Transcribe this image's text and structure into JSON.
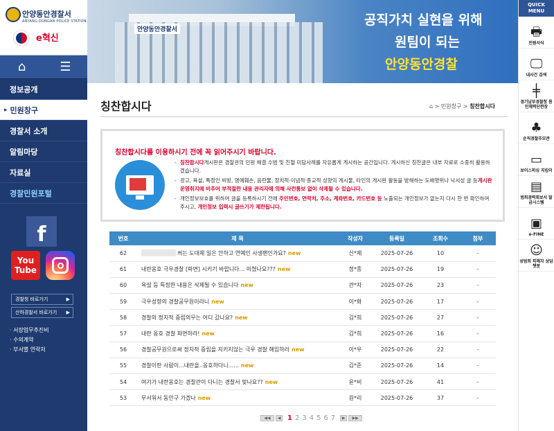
{
  "logo": {
    "name": "안양동안경찰서",
    "sub": "ANYANG DONGAN POLICE STATION",
    "innovation": "e혁신"
  },
  "nav": {
    "items": [
      {
        "label": "정보공개",
        "active": false
      },
      {
        "label": "민원창구",
        "active": true
      },
      {
        "label": "경찰서 소개",
        "active": false
      },
      {
        "label": "알림마당",
        "active": false
      },
      {
        "label": "자료실",
        "active": false
      },
      {
        "label": "경찰민원포털",
        "active": false
      }
    ],
    "active_marker": "▸"
  },
  "social": {
    "facebook": "f",
    "youtube_top": "You",
    "youtube_bottom": "Tube"
  },
  "quick_links": [
    {
      "label": "경찰청 바로가기"
    },
    {
      "label": "산하경찰서 바로가기"
    }
  ],
  "side_links": [
    "· 서장업무추진비",
    "· 수의계약",
    "· 부서별 연락처"
  ],
  "banner": {
    "line1": "공직가치 실현을 위해",
    "line2": "원팀이 되는",
    "line3": "안양동안경찰",
    "building_sign": "안양동안경찰서"
  },
  "quick_menu": {
    "title_1": "QUICK",
    "title_2": "MENU",
    "items": [
      {
        "label": "민원서식",
        "icon": "printer-icon"
      },
      {
        "label": "내사건 검색",
        "icon": "monitor-search-icon"
      },
      {
        "label": "경기남부경찰청 용인체력단련장",
        "icon": "dumbbell-icon"
      },
      {
        "label": "순직경찰추모관",
        "icon": "sprout-icon"
      },
      {
        "label": "보이스피싱 지킴이",
        "icon": "laptop-icon"
      },
      {
        "label": "범죄경력회보서 발급시스템",
        "icon": "printer-doc-icon"
      },
      {
        "label": "e-FINE",
        "icon": "car-monitor-icon"
      },
      {
        "label": "성범죄 피해자 상담 챗봇",
        "icon": "robot-icon"
      }
    ]
  },
  "page": {
    "title": "칭찬합시다",
    "breadcrumb": [
      "민원창구",
      "칭찬합시다"
    ]
  },
  "notice": {
    "title": "칭찬합시다를 이용하시기 전에 꼭 읽어주시기 바랍니다.",
    "item1_hl": "칭찬합시다",
    "item1_text": "게시판은 경찰관의 민원 해결 수범 및 친절 미담사례를 자유롭게 게시하는 공간입니다. 게시하신 칭찬글은 내부 자료로 소중히 활용하겠습니다.",
    "item2_text": "광고, 욕설, 특정인 비방, 명예훼손, 음란물, 정치적·이념적·종교적 성향의 게시물, 타인의 게시판 활동을 방해하는 도배행위나 낙서성 글 등",
    "item2_hl": "게시판 운영취지에 비추어 부적절한 내용 관리자에 의해 사전통보 없이 삭제될 수 있습니다.",
    "item3_pre": "개인정보보호를 위하여 글을 등록하시기 전에",
    "item3_hl": "주민번호, 연락처, 주소, 계좌번호, 카드번호 등",
    "item3_mid": "노출되는 개인정보가 없는지 다시 한 번 확인하여 주시고,",
    "item3_hl2": "개인정보 입력시 글쓰기가 제한됩니다."
  },
  "table": {
    "headers": [
      "번호",
      "제 목",
      "작성자",
      "등록일",
      "조회수",
      "첨부"
    ],
    "new_label": "new",
    "rows": [
      {
        "no": "62",
        "subject": "씌는 도대체 일은 안하고 연예인 사생팬인가요?",
        "author": "신*제",
        "date": "2025-07-26",
        "views": "10",
        "file": "-",
        "blurred": true
      },
      {
        "no": "61",
        "subject": "내란옹호 극우경찰 [파면] 시키기 바랍니다... 미쳤나요???",
        "author": "정*종",
        "date": "2025-07-26",
        "views": "19",
        "file": "-",
        "blurred": false
      },
      {
        "no": "60",
        "subject": "욕설 등 특정한 내용은 삭제될 수 있습니다",
        "author": "관*자",
        "date": "2025-07-26",
        "views": "23",
        "file": "-",
        "blurred": false
      },
      {
        "no": "59",
        "subject": "극우성향의 경찰공무원이라니",
        "author": "이*화",
        "date": "2025-07-26",
        "views": "17",
        "file": "-",
        "blurred": false
      },
      {
        "no": "58",
        "subject": "경찰의 정치적 중립의무는 어디 갔나요?",
        "author": "김*희",
        "date": "2025-07-26",
        "views": "27",
        "file": "-",
        "blurred": false
      },
      {
        "no": "57",
        "subject": "내란 옹호 경찰 파면하라!",
        "author": "김*희",
        "date": "2025-07-26",
        "views": "16",
        "file": "-",
        "blurred": false
      },
      {
        "no": "56",
        "subject": "경찰공무원으로써 정치적 중립을 지키지않는 극우 경찰 해임하라",
        "author": "이*우",
        "date": "2025-07-26",
        "views": "22",
        "file": "-",
        "blurred": false
      },
      {
        "no": "55",
        "subject": "경찰이란 사람이...내란을..옹호하다니......",
        "author": "김*준",
        "date": "2025-07-26",
        "views": "14",
        "file": "-",
        "blurred": false
      },
      {
        "no": "54",
        "subject": "여기가 내란옹호는 경찰관이 다니는 경찰서 맞나요??",
        "author": "윤*비",
        "date": "2025-07-26",
        "views": "41",
        "file": "-",
        "blurred": false
      },
      {
        "no": "53",
        "subject": "무서워서 동안구 가겠나",
        "author": "원*리",
        "date": "2025-07-26",
        "views": "37",
        "file": "-",
        "blurred": false
      }
    ]
  },
  "pager": {
    "pages": [
      "1",
      "2",
      "3",
      "4",
      "5",
      "6",
      "7"
    ],
    "current": "1",
    "first": "◀◀",
    "prev": "◀",
    "next": "▶",
    "last": "▶▶"
  }
}
